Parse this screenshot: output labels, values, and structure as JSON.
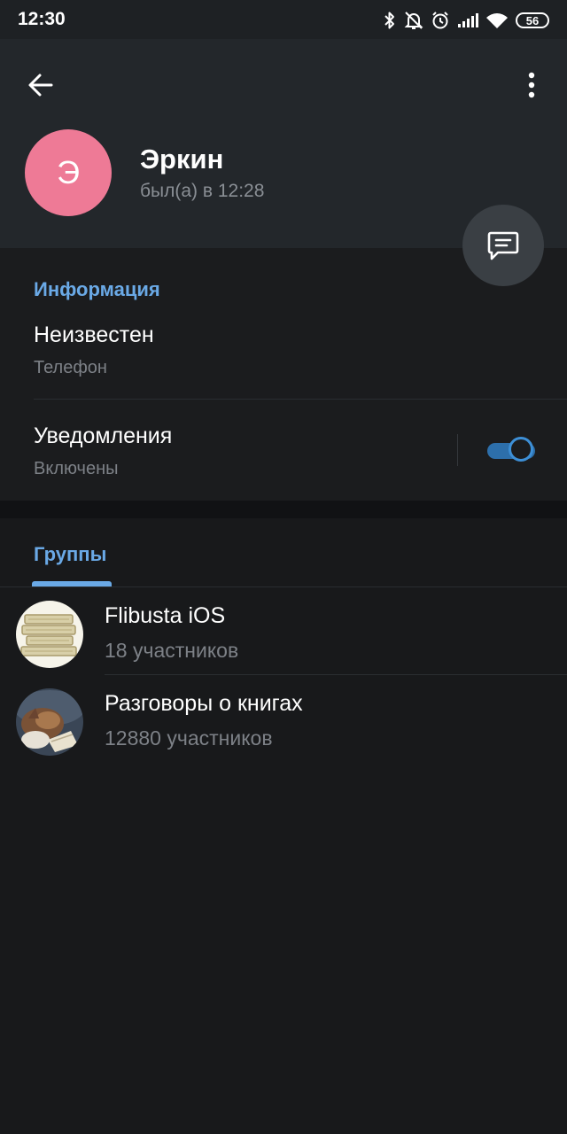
{
  "status_bar": {
    "time": "12:30",
    "battery": "56",
    "icons": [
      "bluetooth-icon",
      "bell-off-icon",
      "alarm-icon",
      "signal-icon",
      "wifi-icon",
      "battery-icon"
    ]
  },
  "header": {
    "avatar_letter": "Э",
    "avatar_color": "#ee7a96",
    "name": "Эркин",
    "last_seen": "был(а) в 12:28"
  },
  "info": {
    "title": "Информация",
    "phone_value": "Неизвестен",
    "phone_label": "Телефон",
    "notifications_title": "Уведомления",
    "notifications_status": "Включены",
    "notifications_on": true
  },
  "groups": {
    "tab_label": "Группы",
    "items": [
      {
        "name": "Flibusta iOS",
        "members": "18 участников"
      },
      {
        "name": "Разговоры о книгах",
        "members": "12880 участников"
      }
    ]
  },
  "colors": {
    "accent": "#6aa9e6",
    "background": "#18191b",
    "header": "#23272b"
  }
}
